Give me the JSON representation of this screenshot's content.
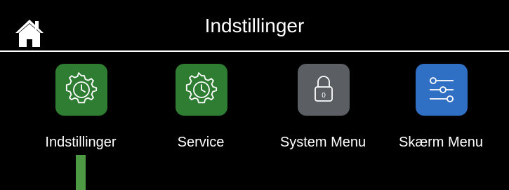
{
  "header": {
    "title": "Indstillinger",
    "home_icon": "home-icon"
  },
  "tiles": [
    {
      "label": "Indstillinger",
      "icon": "gear-clock-icon",
      "color": "#2e7d32"
    },
    {
      "label": "Service",
      "icon": "gear-clock-icon",
      "color": "#2e7d32"
    },
    {
      "label": "System Menu",
      "icon": "padlock-icon",
      "color": "#5b5e63"
    },
    {
      "label": "Skærm Menu",
      "icon": "sliders-icon",
      "color": "#2f6fc4"
    }
  ],
  "selection": {
    "active_index": 0,
    "color": "#4e9a44"
  },
  "colors": {
    "background": "#000000",
    "text": "#ffffff"
  }
}
